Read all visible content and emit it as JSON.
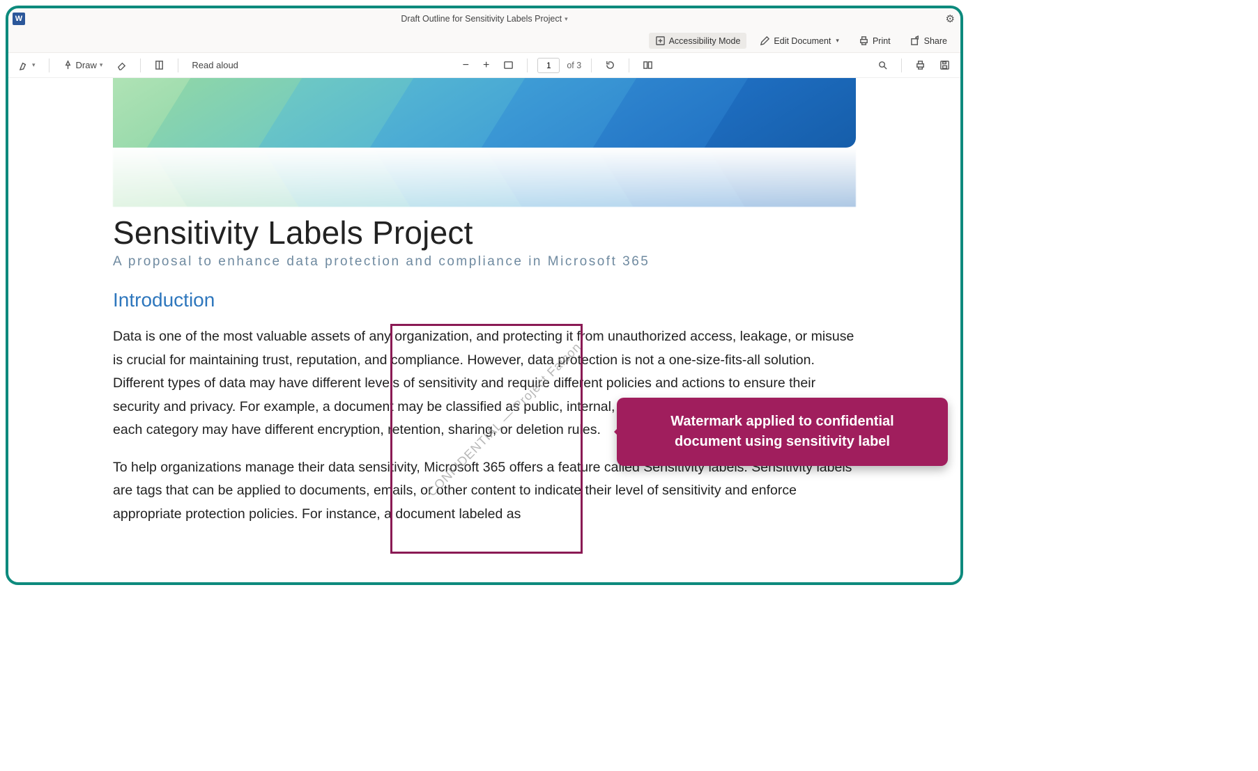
{
  "titlebar": {
    "app_letter": "W",
    "doc_title": "Draft Outline for Sensitivity Labels Project"
  },
  "cmdbar": {
    "accessibility": "Accessibility Mode",
    "edit": "Edit Document",
    "print": "Print",
    "share": "Share"
  },
  "toolbar": {
    "draw": "Draw",
    "read_aloud": "Read aloud",
    "page_current": "1",
    "page_of": "of 3"
  },
  "document": {
    "title": "Sensitivity Labels Project",
    "subtitle": "A proposal to enhance data protection and compliance in Microsoft 365",
    "section_heading": "Introduction",
    "para1": "Data is one of the most valuable assets of any organization, and protecting it from unauthorized access, leakage, or misuse is crucial for maintaining trust, reputation, and compliance. However, data protection is not a one-size-fits-all solution. Different types of data may have different levels of sensitivity and require different policies and actions to ensure their security and privacy. For example, a document may be classified as public, internal, confidential, or highly confidential, and each category may have different encryption, retention, sharing, or deletion rules.",
    "para2": "To help organizations manage their data sensitivity, Microsoft 365 offers a feature called Sensitivity labels. Sensitivity labels are tags that can be applied to documents, emails, or other content to indicate their level of sensitivity and enforce appropriate protection policies. For instance, a document labeled as",
    "watermark_text": "CONFIDENTIAL — Project Falcon"
  },
  "callout": {
    "line1": "Watermark applied to confidential",
    "line2": "document using sensitivity label"
  }
}
